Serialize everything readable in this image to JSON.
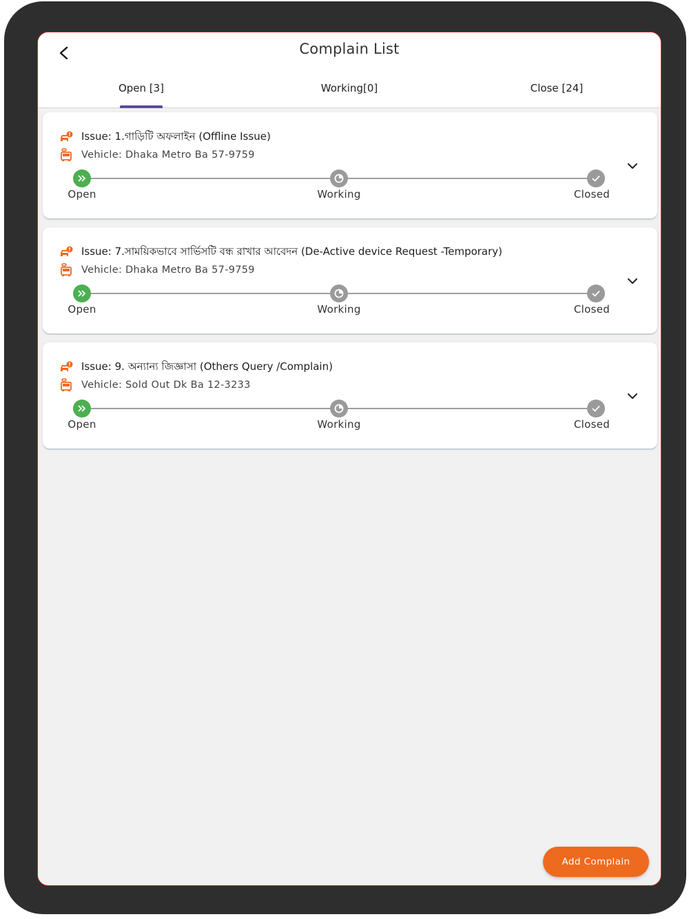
{
  "header": {
    "title": "Complain List",
    "tabs": [
      {
        "label": "Open [3]",
        "active": true
      },
      {
        "label": "Working[0]",
        "active": false
      },
      {
        "label": "Close [24]",
        "active": false
      }
    ]
  },
  "complaints": [
    {
      "issue": "Issue: 1.গাড়িটি অফলাইন  (Offline Issue)",
      "vehicle": "Vehicle: Dhaka Metro Ba 57-9759",
      "steps": [
        "Open",
        "Working",
        "Closed"
      ]
    },
    {
      "issue": "Issue: 7.সাময়িকভাবে সার্ভিসটি বন্ধ রাখার  আবেদন (De-Active device Request -Temporary)",
      "vehicle": "Vehicle: Dhaka Metro Ba 57-9759",
      "steps": [
        "Open",
        "Working",
        "Closed"
      ]
    },
    {
      "issue": "Issue: 9. অন্যান্য জিজ্ঞাসা (Others Query /Complain)",
      "vehicle": "Vehicle: Sold Out Dk Ba 12-3233",
      "steps": [
        "Open",
        "Working",
        "Closed"
      ]
    }
  ],
  "fab": {
    "label": "Add Complain"
  },
  "colors": {
    "accent": "#ee6a1e",
    "tab_indicator": "#5b4a9c",
    "step_active": "#4caf50",
    "step_inactive": "#9a9a9a",
    "frame_border": "#c62828"
  },
  "icons": {
    "back": "arrow-back-icon",
    "issue": "car-alert-icon",
    "vehicle": "bus-icon",
    "expand": "chevron-down-icon",
    "step_open": "double-chevron-right-icon",
    "step_working": "progress-clock-icon",
    "step_closed": "check-icon"
  }
}
